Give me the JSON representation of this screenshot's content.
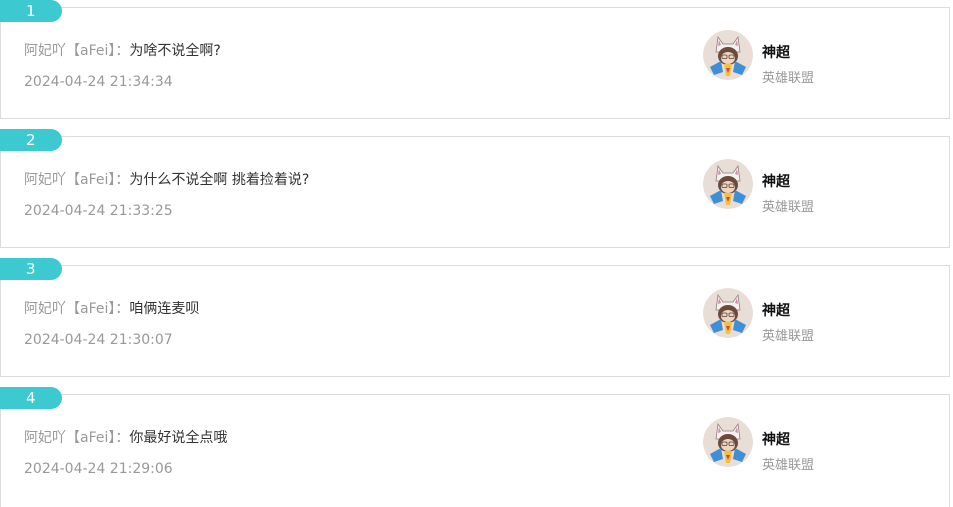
{
  "comments": [
    {
      "index": "1",
      "author": "阿妃吖【aFei】",
      "separator": "：",
      "text": "为啥不说全啊?",
      "time": "2024-04-24 21:34:34",
      "streamer": "神超",
      "game": "英雄联盟"
    },
    {
      "index": "2",
      "author": "阿妃吖【aFei】",
      "separator": "：",
      "text": "为什么不说全啊 挑着捡着说?",
      "time": "2024-04-24 21:33:25",
      "streamer": "神超",
      "game": "英雄联盟"
    },
    {
      "index": "3",
      "author": "阿妃吖【aFei】",
      "separator": "：",
      "text": "咱俩连麦呗",
      "time": "2024-04-24 21:30:07",
      "streamer": "神超",
      "game": "英雄联盟"
    },
    {
      "index": "4",
      "author": "阿妃吖【aFei】",
      "separator": "：",
      "text": "你最好说全点哦",
      "time": "2024-04-24 21:29:06",
      "streamer": "神超",
      "game": "英雄联盟"
    }
  ],
  "colors": {
    "badge": "#3cc9d0",
    "muted": "#999999",
    "text": "#333333",
    "border": "#dcdcdc"
  },
  "icons": {
    "avatar": "streamer-avatar-icon"
  }
}
